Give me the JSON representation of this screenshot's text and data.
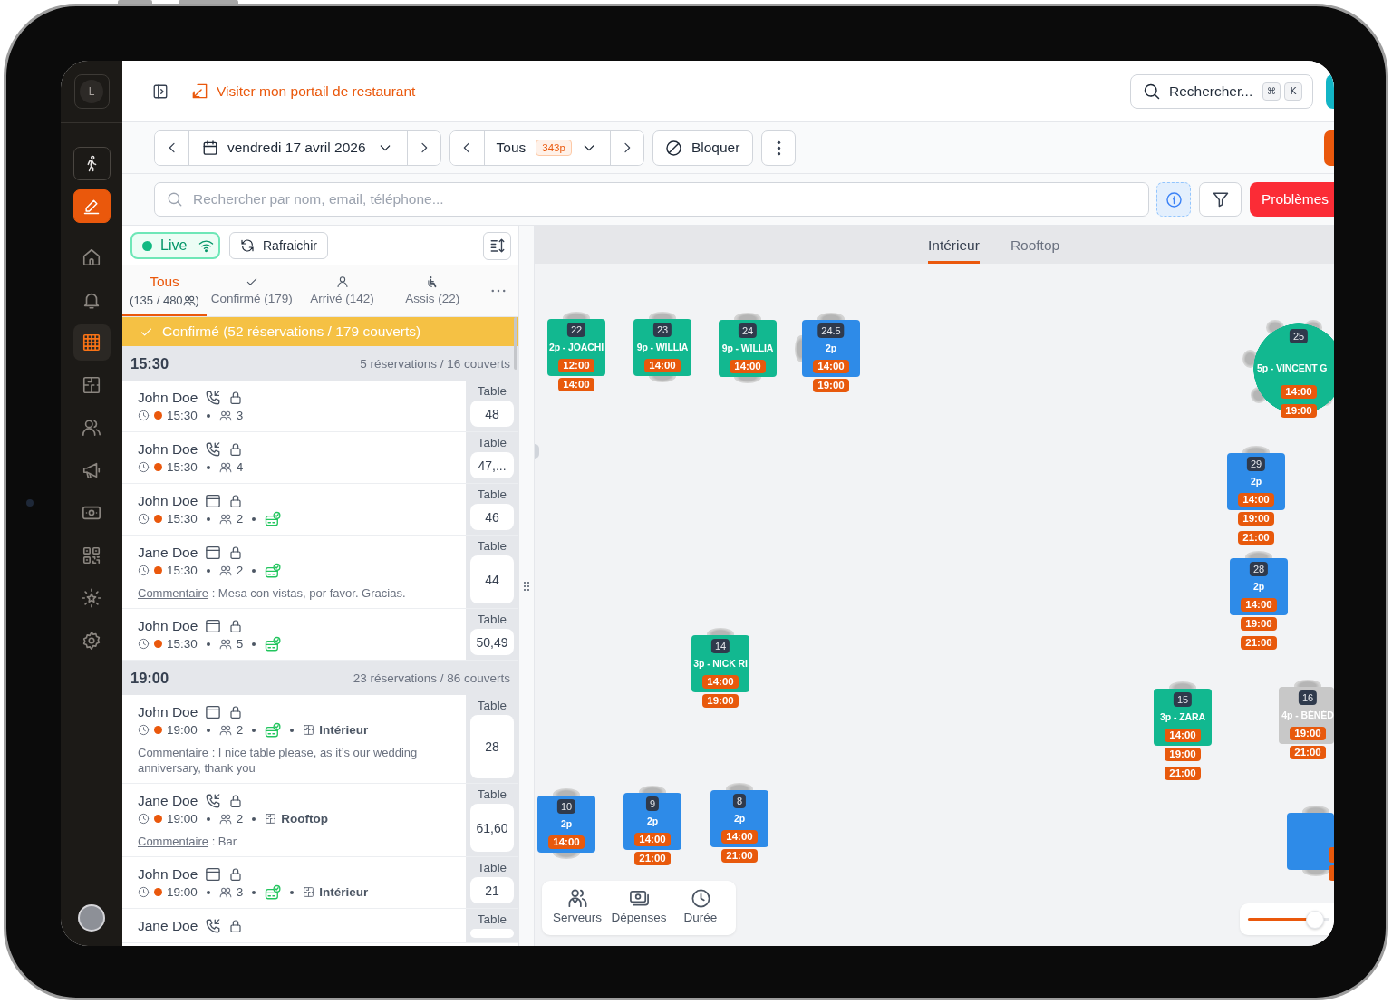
{
  "sidebar": {
    "account": "L",
    "actions": [
      {
        "kind": "outline"
      },
      {
        "kind": "filled"
      }
    ],
    "nav": [
      {
        "selected": false
      },
      {
        "selected": false
      },
      {
        "selected": true
      },
      {
        "selected": false
      },
      {
        "selected": false
      },
      {
        "selected": false
      },
      {
        "selected": false
      },
      {
        "selected": false
      },
      {
        "selected": false
      },
      {
        "selected": false
      }
    ]
  },
  "header": {
    "portal_link": "Visiter mon portail de restaurant",
    "search": {
      "label": "Rechercher...",
      "keys": [
        "⌘",
        "K"
      ]
    }
  },
  "toolbar": {
    "date": "vendredi 17 avril 2026",
    "service": {
      "label": "Tous",
      "covers": "343p"
    },
    "block_button": "Bloquer"
  },
  "search_bar": {
    "placeholder": "Rechercher par nom, email, téléphone...",
    "info_active": true,
    "problems_button": "Problèmes"
  },
  "reservations_panel": {
    "live": {
      "label": "Live",
      "on": true
    },
    "refresh_button": "Rafraichir",
    "status_tabs": [
      {
        "kind": "all",
        "label": "Tous",
        "count": "(135 / 480",
        "count_end": ")",
        "selected": true
      },
      {
        "kind": "confirmed",
        "label": "Confirmé (179)",
        "selected": false
      },
      {
        "kind": "arrived",
        "label": "Arrivé (142)",
        "selected": false
      },
      {
        "kind": "seated",
        "label": "Assis (22)",
        "selected": false
      }
    ],
    "banner": "Confirmé (52 réservations / 179 couverts)",
    "groups": [
      {
        "time": "15:30",
        "summary": "5 réservations / 16 couverts",
        "reservations": [
          {
            "name": "John Doe",
            "kind": "phone",
            "locked": true,
            "time": "15:30",
            "guests": "3",
            "deposit": false,
            "table_label": "Table",
            "table": "48"
          },
          {
            "name": "John Doe",
            "kind": "phone",
            "locked": true,
            "time": "15:30",
            "guests": "4",
            "deposit": false,
            "table_label": "Table",
            "table": "47,..."
          },
          {
            "name": "John Doe",
            "kind": "web",
            "locked": true,
            "time": "15:30",
            "guests": "2",
            "deposit": true,
            "table_label": "Table",
            "table": "46"
          },
          {
            "name": "Jane Doe",
            "kind": "web",
            "locked": true,
            "time": "15:30",
            "guests": "2",
            "deposit": true,
            "comment_label": "Commentaire",
            "comment": ": Mesa con vistas, por favor. Gracias.",
            "table_label": "Table",
            "table": "44"
          },
          {
            "name": "John Doe",
            "kind": "web",
            "locked": true,
            "time": "15:30",
            "guests": "5",
            "deposit": true,
            "table_label": "Table",
            "table": "50,49"
          }
        ]
      },
      {
        "time": "19:00",
        "summary": "23 réservations / 86 couverts",
        "reservations": [
          {
            "name": "John Doe",
            "kind": "web",
            "locked": true,
            "time": "19:00",
            "guests": "2",
            "deposit": true,
            "area": "Intérieur",
            "comment_label": "Commentaire",
            "comment": ": I nice table please, as it’s our wedding anniversary, thank you",
            "table_label": "Table",
            "table": "28"
          },
          {
            "name": "Jane Doe",
            "kind": "phone",
            "locked": true,
            "time": "19:00",
            "guests": "2",
            "deposit": false,
            "area": "Rooftop",
            "comment_label": "Commentaire",
            "comment": ": Bar",
            "table_label": "Table",
            "table": "61,60"
          },
          {
            "name": "John Doe",
            "kind": "web",
            "locked": true,
            "time": "19:00",
            "guests": "3",
            "deposit": true,
            "area": "Intérieur",
            "table_label": "Table",
            "table": "21"
          },
          {
            "name": "Jane Doe",
            "kind": "phone",
            "locked": true,
            "table_label": "Table"
          }
        ]
      }
    ]
  },
  "floor_plan": {
    "tabs": [
      {
        "label": "Intérieur",
        "selected": true
      },
      {
        "label": "Rooftop",
        "selected": false
      }
    ],
    "tables": [
      {
        "number": "22",
        "kind": "square",
        "color": "#12b890",
        "label": "2p - JOACHI",
        "times": [
          "12:00",
          "14:00"
        ]
      },
      {
        "number": "23",
        "kind": "square",
        "color": "#12b890",
        "label": "9p - WILLIA",
        "times": [
          "14:00"
        ]
      },
      {
        "number": "24",
        "kind": "square",
        "color": "#12b890",
        "label": "9p - WILLIA",
        "times": [
          "14:00"
        ]
      },
      {
        "number": "24.5",
        "kind": "square",
        "color": "#2e8be8",
        "label": "2p",
        "times": [
          "14:00",
          "19:00"
        ]
      },
      {
        "number": "25",
        "kind": "round",
        "color": "#12b890",
        "label": "5p - VINCENT G",
        "times": [
          "14:00",
          "19:00"
        ]
      },
      {
        "number": "29",
        "kind": "square",
        "color": "#2e8be8",
        "label": "2p",
        "times": [
          "14:00",
          "19:00",
          "21:00"
        ]
      },
      {
        "number": "28",
        "kind": "square",
        "color": "#2e8be8",
        "label": "2p",
        "times": [
          "14:00",
          "19:00",
          "21:00"
        ]
      },
      {
        "number": "14",
        "kind": "square",
        "color": "#12b890",
        "label": "3p - NICK RI",
        "times": [
          "14:00",
          "19:00"
        ]
      },
      {
        "number": "15",
        "kind": "square",
        "color": "#12b890",
        "label": "3p - ZARA",
        "times": [
          "14:00",
          "19:00",
          "21:00"
        ]
      },
      {
        "number": "16",
        "kind": "square",
        "color": "#c8c8c8",
        "label": "4p - BÉNÉD",
        "times": [
          "19:00",
          "21:00"
        ]
      },
      {
        "number": "10",
        "kind": "square",
        "color": "#2e8be8",
        "label": "2p",
        "times": [
          "14:00"
        ]
      },
      {
        "number": "9",
        "kind": "square",
        "color": "#2e8be8",
        "label": "2p",
        "times": [
          "14:00",
          "21:00"
        ]
      },
      {
        "number": "8",
        "kind": "square",
        "color": "#2e8be8",
        "label": "2p",
        "times": [
          "14:00",
          "21:00"
        ]
      },
      {
        "kind": "square",
        "color": "#2e8be8"
      }
    ],
    "tools": [
      {
        "label": "Serveurs"
      },
      {
        "label": "Dépenses"
      },
      {
        "label": "Durée"
      }
    ],
    "zoom": {
      "level": 0.83
    }
  }
}
